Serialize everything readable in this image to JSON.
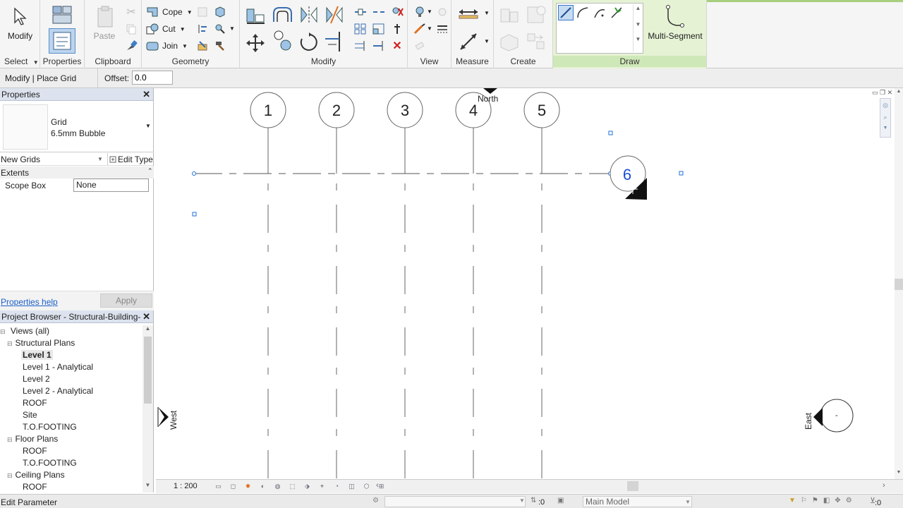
{
  "ribbon": {
    "panels": {
      "select": "Select",
      "properties": "Properties",
      "clipboard": "Clipboard",
      "geometry": "Geometry",
      "modify": "Modify",
      "view": "View",
      "measure": "Measure",
      "create": "Create",
      "draw": "Draw"
    },
    "modify_button": "Modify",
    "paste_button": "Paste",
    "cope": "Cope",
    "cut": "Cut",
    "join": "Join",
    "multi_segment": "Multi-Segment",
    "dropdown_arrow": "▼"
  },
  "options_bar": {
    "context": "Modify | Place Grid",
    "offset_label": "Offset:",
    "offset_value": "0.0"
  },
  "properties": {
    "title": "Properties",
    "close": "✕",
    "type_name": "Grid",
    "type_value": "6.5mm Bubble",
    "selector": "New Grids",
    "edit_type": "Edit Type",
    "group": "Extents",
    "rows": [
      {
        "label": "Scope Box",
        "value": "None"
      }
    ],
    "help_link": "Properties help",
    "apply": "Apply"
  },
  "project_browser": {
    "title": "Project Browser - Structural-Building-...",
    "close": "✕",
    "root": "Views (all)",
    "items": [
      {
        "label": "Structural Plans",
        "level": 1
      },
      {
        "label": "Level 1",
        "level": 2,
        "selected": true
      },
      {
        "label": "Level 1 - Analytical",
        "level": 2
      },
      {
        "label": "Level 2",
        "level": 2
      },
      {
        "label": "Level 2 - Analytical",
        "level": 2
      },
      {
        "label": "ROOF",
        "level": 2
      },
      {
        "label": "Site",
        "level": 2
      },
      {
        "label": "T.O.FOOTING",
        "level": 2
      },
      {
        "label": "Floor Plans",
        "level": 1
      },
      {
        "label": "ROOF",
        "level": 2
      },
      {
        "label": "T.O.FOOTING",
        "level": 2
      },
      {
        "label": "Ceiling Plans",
        "level": 1
      },
      {
        "label": "ROOF",
        "level": 2
      }
    ]
  },
  "canvas": {
    "grids": [
      "1",
      "2",
      "3",
      "4",
      "5"
    ],
    "new_grid": "6",
    "north": "North",
    "west": "West",
    "east": "East",
    "east_bubble": "-"
  },
  "view_bar": {
    "scale": "1 : 200"
  },
  "status_bar": {
    "message": "Edit Parameter",
    "workset_count": ":0",
    "model": "Main Model",
    "filter_count": ":0"
  },
  "colors": {
    "draw_panel": "#cfe8b8",
    "grid_new": "#1a4fd6",
    "selection": "#1e6fd9"
  }
}
